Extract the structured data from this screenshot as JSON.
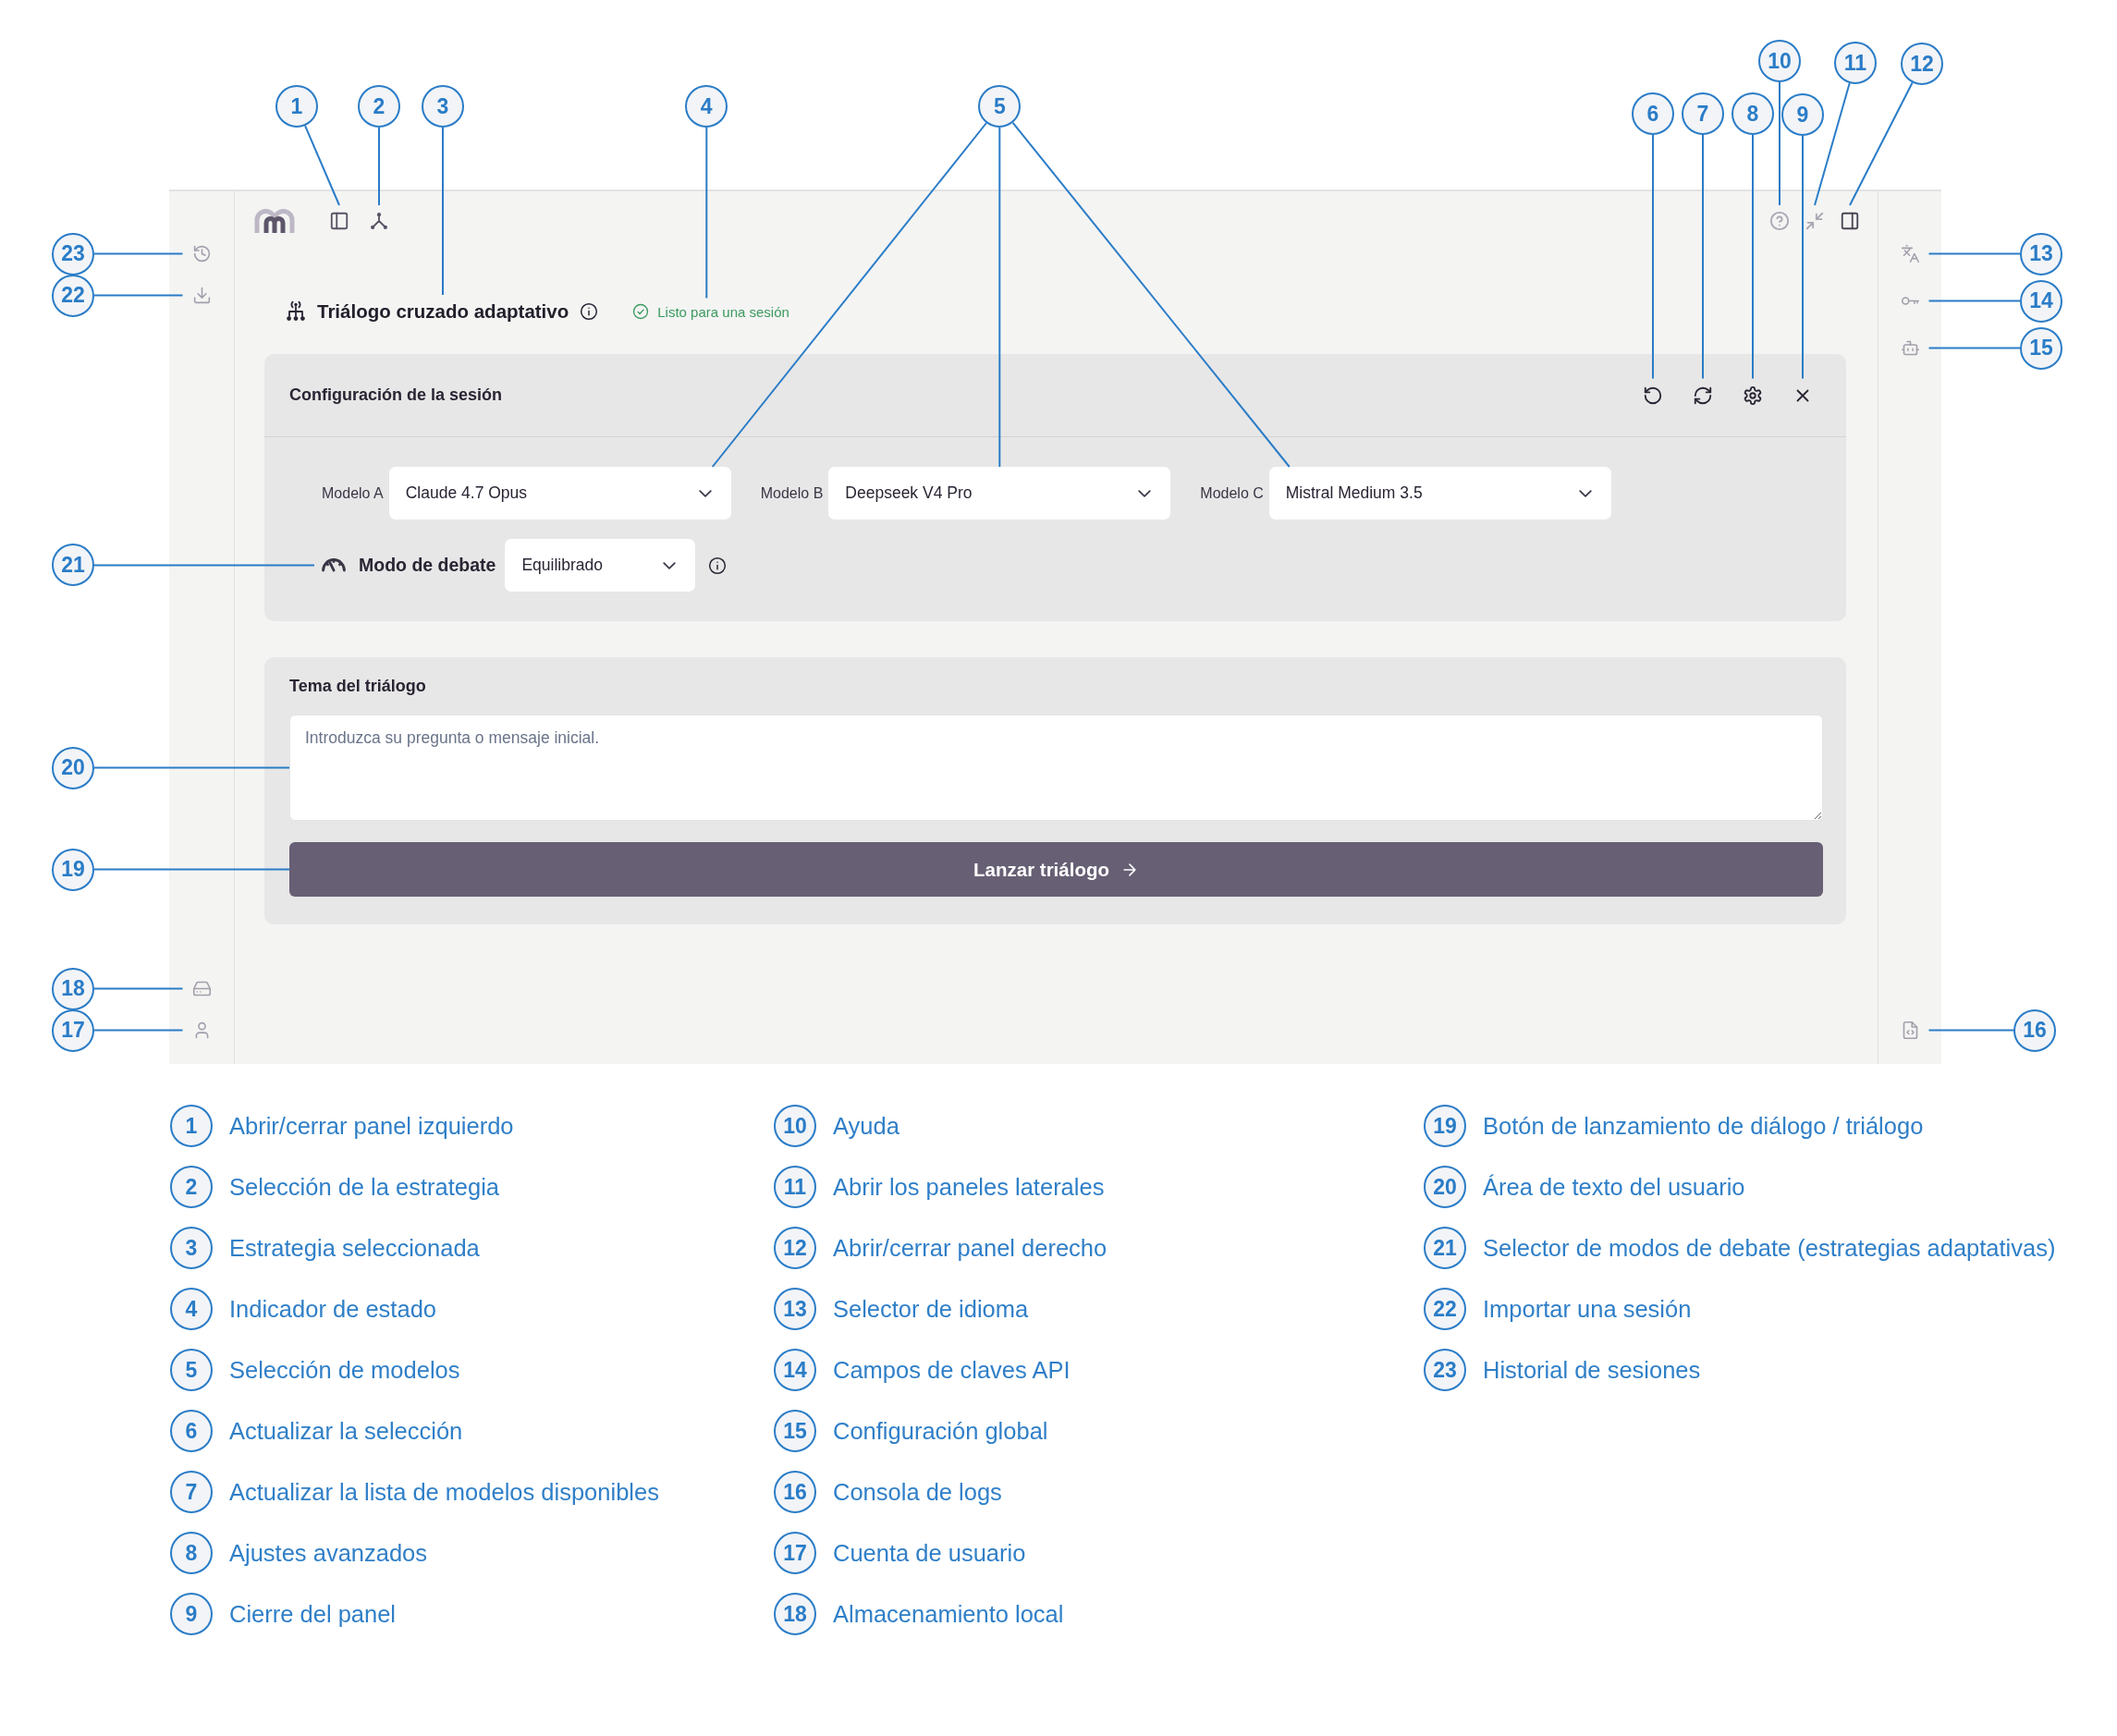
{
  "app": {
    "strategy": {
      "title": "Triálogo cruzado adaptativo",
      "status": "Listo para una sesión"
    },
    "session_panel": {
      "title": "Configuración de la sesión",
      "models": [
        {
          "label": "Modelo A",
          "value": "Claude 4.7 Opus"
        },
        {
          "label": "Modelo B",
          "value": "Deepseek V4 Pro"
        },
        {
          "label": "Modelo C",
          "value": "Mistral Medium 3.5"
        }
      ],
      "debate_mode": {
        "label": "Modo de debate",
        "value": "Equilibrado"
      }
    },
    "topic_panel": {
      "label": "Tema del triálogo",
      "placeholder": "Introduzca su pregunta o mensaje inicial.",
      "button": "Lanzar triálogo"
    }
  },
  "callouts": [
    "10",
    "11",
    "12",
    "1",
    "2",
    "3",
    "4",
    "5",
    "6",
    "7",
    "8",
    "9",
    "23",
    "13",
    "22",
    "14",
    "15",
    "21",
    "20",
    "19",
    "18",
    "17",
    "16"
  ],
  "legend": [
    {
      "number": "1",
      "text": "Abrir/cerrar panel izquierdo"
    },
    {
      "number": "2",
      "text": "Selección de la estrategia"
    },
    {
      "number": "3",
      "text": "Estrategia seleccionada"
    },
    {
      "number": "4",
      "text": "Indicador de estado"
    },
    {
      "number": "5",
      "text": "Selección de modelos"
    },
    {
      "number": "6",
      "text": "Actualizar la selección"
    },
    {
      "number": "7",
      "text": "Actualizar la lista de modelos disponibles"
    },
    {
      "number": "8",
      "text": "Ajustes avanzados"
    },
    {
      "number": "9",
      "text": "Cierre del panel"
    },
    {
      "number": "10",
      "text": "Ayuda"
    },
    {
      "number": "11",
      "text": "Abrir los paneles laterales"
    },
    {
      "number": "12",
      "text": "Abrir/cerrar panel derecho"
    },
    {
      "number": "13",
      "text": "Selector de idioma"
    },
    {
      "number": "14",
      "text": "Campos de claves API"
    },
    {
      "number": "15",
      "text": "Configuración global"
    },
    {
      "number": "16",
      "text": "Consola de logs"
    },
    {
      "number": "17",
      "text": "Cuenta de usuario"
    },
    {
      "number": "18",
      "text": "Almacenamiento local"
    },
    {
      "number": "19",
      "text": "Botón de lanzamiento de diálogo / triálogo"
    },
    {
      "number": "20",
      "text": "Área de texto del usuario"
    },
    {
      "number": "21",
      "text": "Selector de modos de debate (estrategias adaptativas)"
    },
    {
      "number": "22",
      "text": "Importar una sesión"
    },
    {
      "number": "23",
      "text": "Historial de sesiones"
    }
  ]
}
